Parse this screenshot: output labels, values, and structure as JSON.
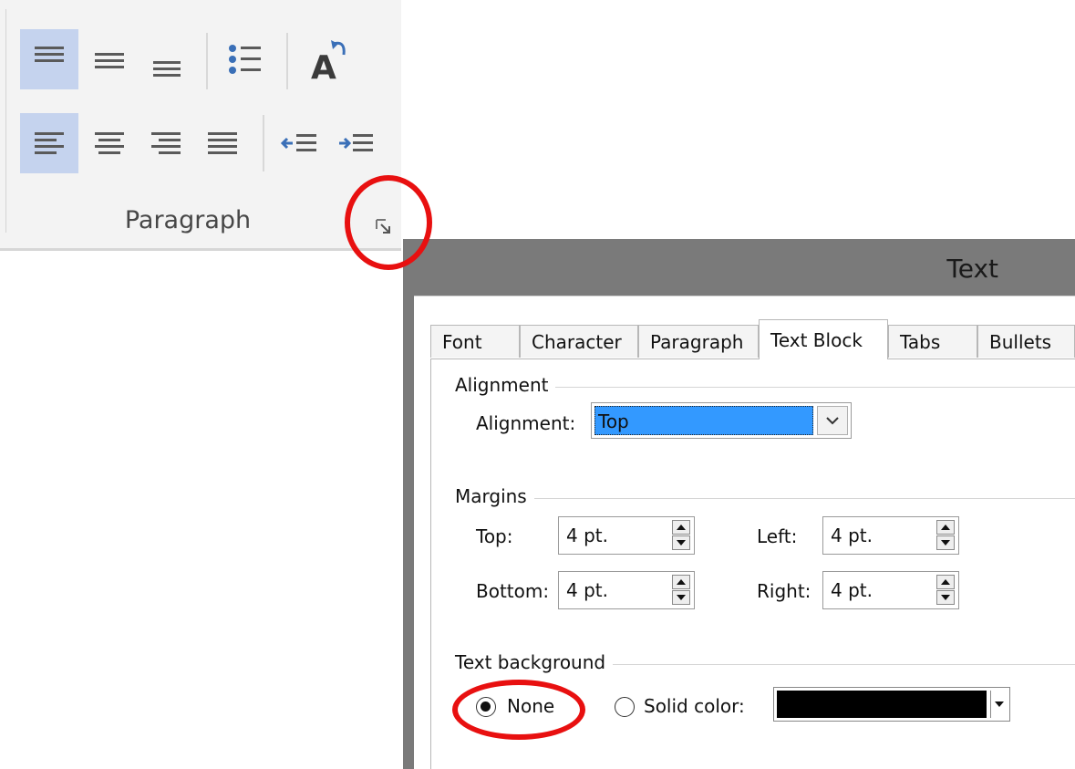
{
  "ribbon": {
    "group_label": "Paragraph"
  },
  "dialog": {
    "title": "Text",
    "tabs": [
      {
        "label": "Font"
      },
      {
        "label": "Character"
      },
      {
        "label": "Paragraph"
      },
      {
        "label": "Text Block"
      },
      {
        "label": "Tabs"
      },
      {
        "label": "Bullets"
      }
    ],
    "alignment": {
      "section_title": "Alignment",
      "label": "Alignment:",
      "value": "Top"
    },
    "margins": {
      "section_title": "Margins",
      "top_label": "Top:",
      "top_value": "4 pt.",
      "bottom_label": "Bottom:",
      "bottom_value": "4 pt.",
      "left_label": "Left:",
      "left_value": "4 pt.",
      "right_label": "Right:",
      "right_value": "4 pt."
    },
    "text_background": {
      "section_title": "Text background",
      "none_label": "None",
      "solid_label": "Solid color:",
      "selected": "None",
      "solid_color": "#000000"
    }
  },
  "colors": {
    "ribbon_selected": "#c5d3ee",
    "selection_blue": "#3399ff",
    "annotation_red": "#e81010"
  }
}
